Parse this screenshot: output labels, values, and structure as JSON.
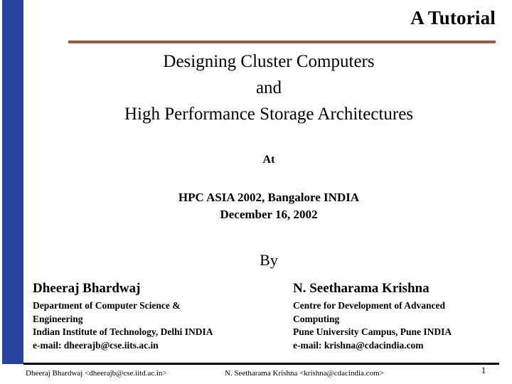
{
  "slide": {
    "header": {
      "tutorial_label": "A Tutorial",
      "rule_color": "#A05A43"
    },
    "accent": {
      "band_color": "#27439B",
      "footer_rule_color": "#000000"
    },
    "title": {
      "lines": [
        "Designing Cluster Computers",
        "and",
        "High Performance Storage Architectures"
      ]
    },
    "venue": {
      "at_label": "At",
      "lines": [
        "HPC ASIA 2002, Bangalore INDIA",
        "December 16, 2002"
      ]
    },
    "by_label": "By",
    "authors": [
      {
        "name": "Dheeraj Bhardwaj",
        "details": [
          "Department of Computer Science &",
          "Engineering",
          "Indian Institute of Technology, Delhi INDIA",
          "e-mail: dheerajb@cse.iits.ac.in"
        ]
      },
      {
        "name": "N. Seetharama Krishna",
        "details": [
          "Centre for Development of Advanced",
          "Computing",
          "Pune University Campus, Pune INDIA",
          "e-mail: krishna@cdacindia.com"
        ]
      }
    ],
    "footer": {
      "left": "Dheeraj Bhardwaj <dheerajb@cse.iitd.ac.in>",
      "right": "N. Seetharama Krishna <krishna@cdacindia.com>",
      "page_number": "1"
    }
  }
}
